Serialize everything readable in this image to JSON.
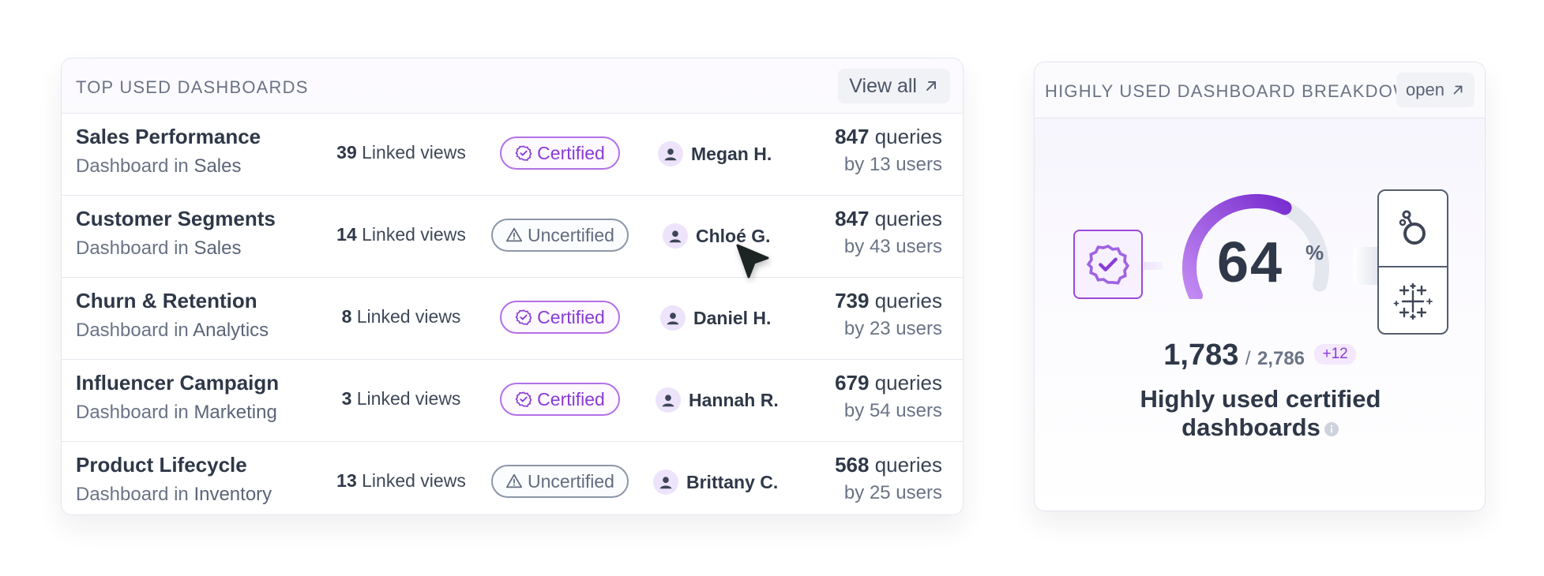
{
  "top_dashboards": {
    "title": "TOP USED DASHBOARDS",
    "view_all_label": "View all",
    "rows": [
      {
        "name": "Sales Performance",
        "sub_prefix": "Dashboard in",
        "category": "Sales",
        "linked_count": "39",
        "linked_label": "Linked views",
        "status": "Certified",
        "owner": "Megan H.",
        "queries": "847",
        "queries_label": "queries",
        "users_label": "by 13 users"
      },
      {
        "name": "Customer Segments",
        "sub_prefix": "Dashboard in",
        "category": "Sales",
        "linked_count": "14",
        "linked_label": "Linked views",
        "status": "Uncertified",
        "owner": "Chloé G.",
        "queries": "847",
        "queries_label": "queries",
        "users_label": "by 43 users"
      },
      {
        "name": "Churn & Retention",
        "sub_prefix": "Dashboard in",
        "category": "Analytics",
        "linked_count": "8",
        "linked_label": "Linked views",
        "status": "Certified",
        "owner": "Daniel H.",
        "queries": "739",
        "queries_label": "queries",
        "users_label": "by 23 users"
      },
      {
        "name": "Influencer Campaign",
        "sub_prefix": "Dashboard in",
        "category": "Marketing",
        "linked_count": "3",
        "linked_label": "Linked views",
        "status": "Certified",
        "owner": "Hannah R.",
        "queries": "679",
        "queries_label": "queries",
        "users_label": "by 54 users"
      },
      {
        "name": "Product Lifecycle",
        "sub_prefix": "Dashboard in",
        "category": "Inventory",
        "linked_count": "13",
        "linked_label": "Linked views",
        "status": "Uncertified",
        "owner": "Brittany C.",
        "queries": "568",
        "queries_label": "queries",
        "users_label": "by 25 users"
      }
    ]
  },
  "breakdown": {
    "title": "HIGHLY USED DASHBOARD BREAKDOWN",
    "open_label": "open",
    "gauge_value": "64",
    "gauge_percent": 64,
    "gauge_unit": "%",
    "count": "1,783",
    "separator": "/",
    "total": "2,786",
    "delta": "+12",
    "caption_line1": "Highly used certified",
    "caption_line2": "dashboards"
  },
  "colors": {
    "accent": "#8a3bd6",
    "uncertified": "#626b7f",
    "text_dark": "#2f3848"
  },
  "icons": {
    "certified_badge": "check-circle-icon",
    "uncertified_badge": "warning-triangle-icon",
    "owner": "user-avatar-icon",
    "view_all": "arrow-up-right-icon",
    "cert_seal": "certified-seal-icon",
    "tool_1": "looker-logo-icon",
    "tool_2": "tableau-logo-icon",
    "info": "info-icon",
    "cursor": "mouse-cursor-icon"
  }
}
